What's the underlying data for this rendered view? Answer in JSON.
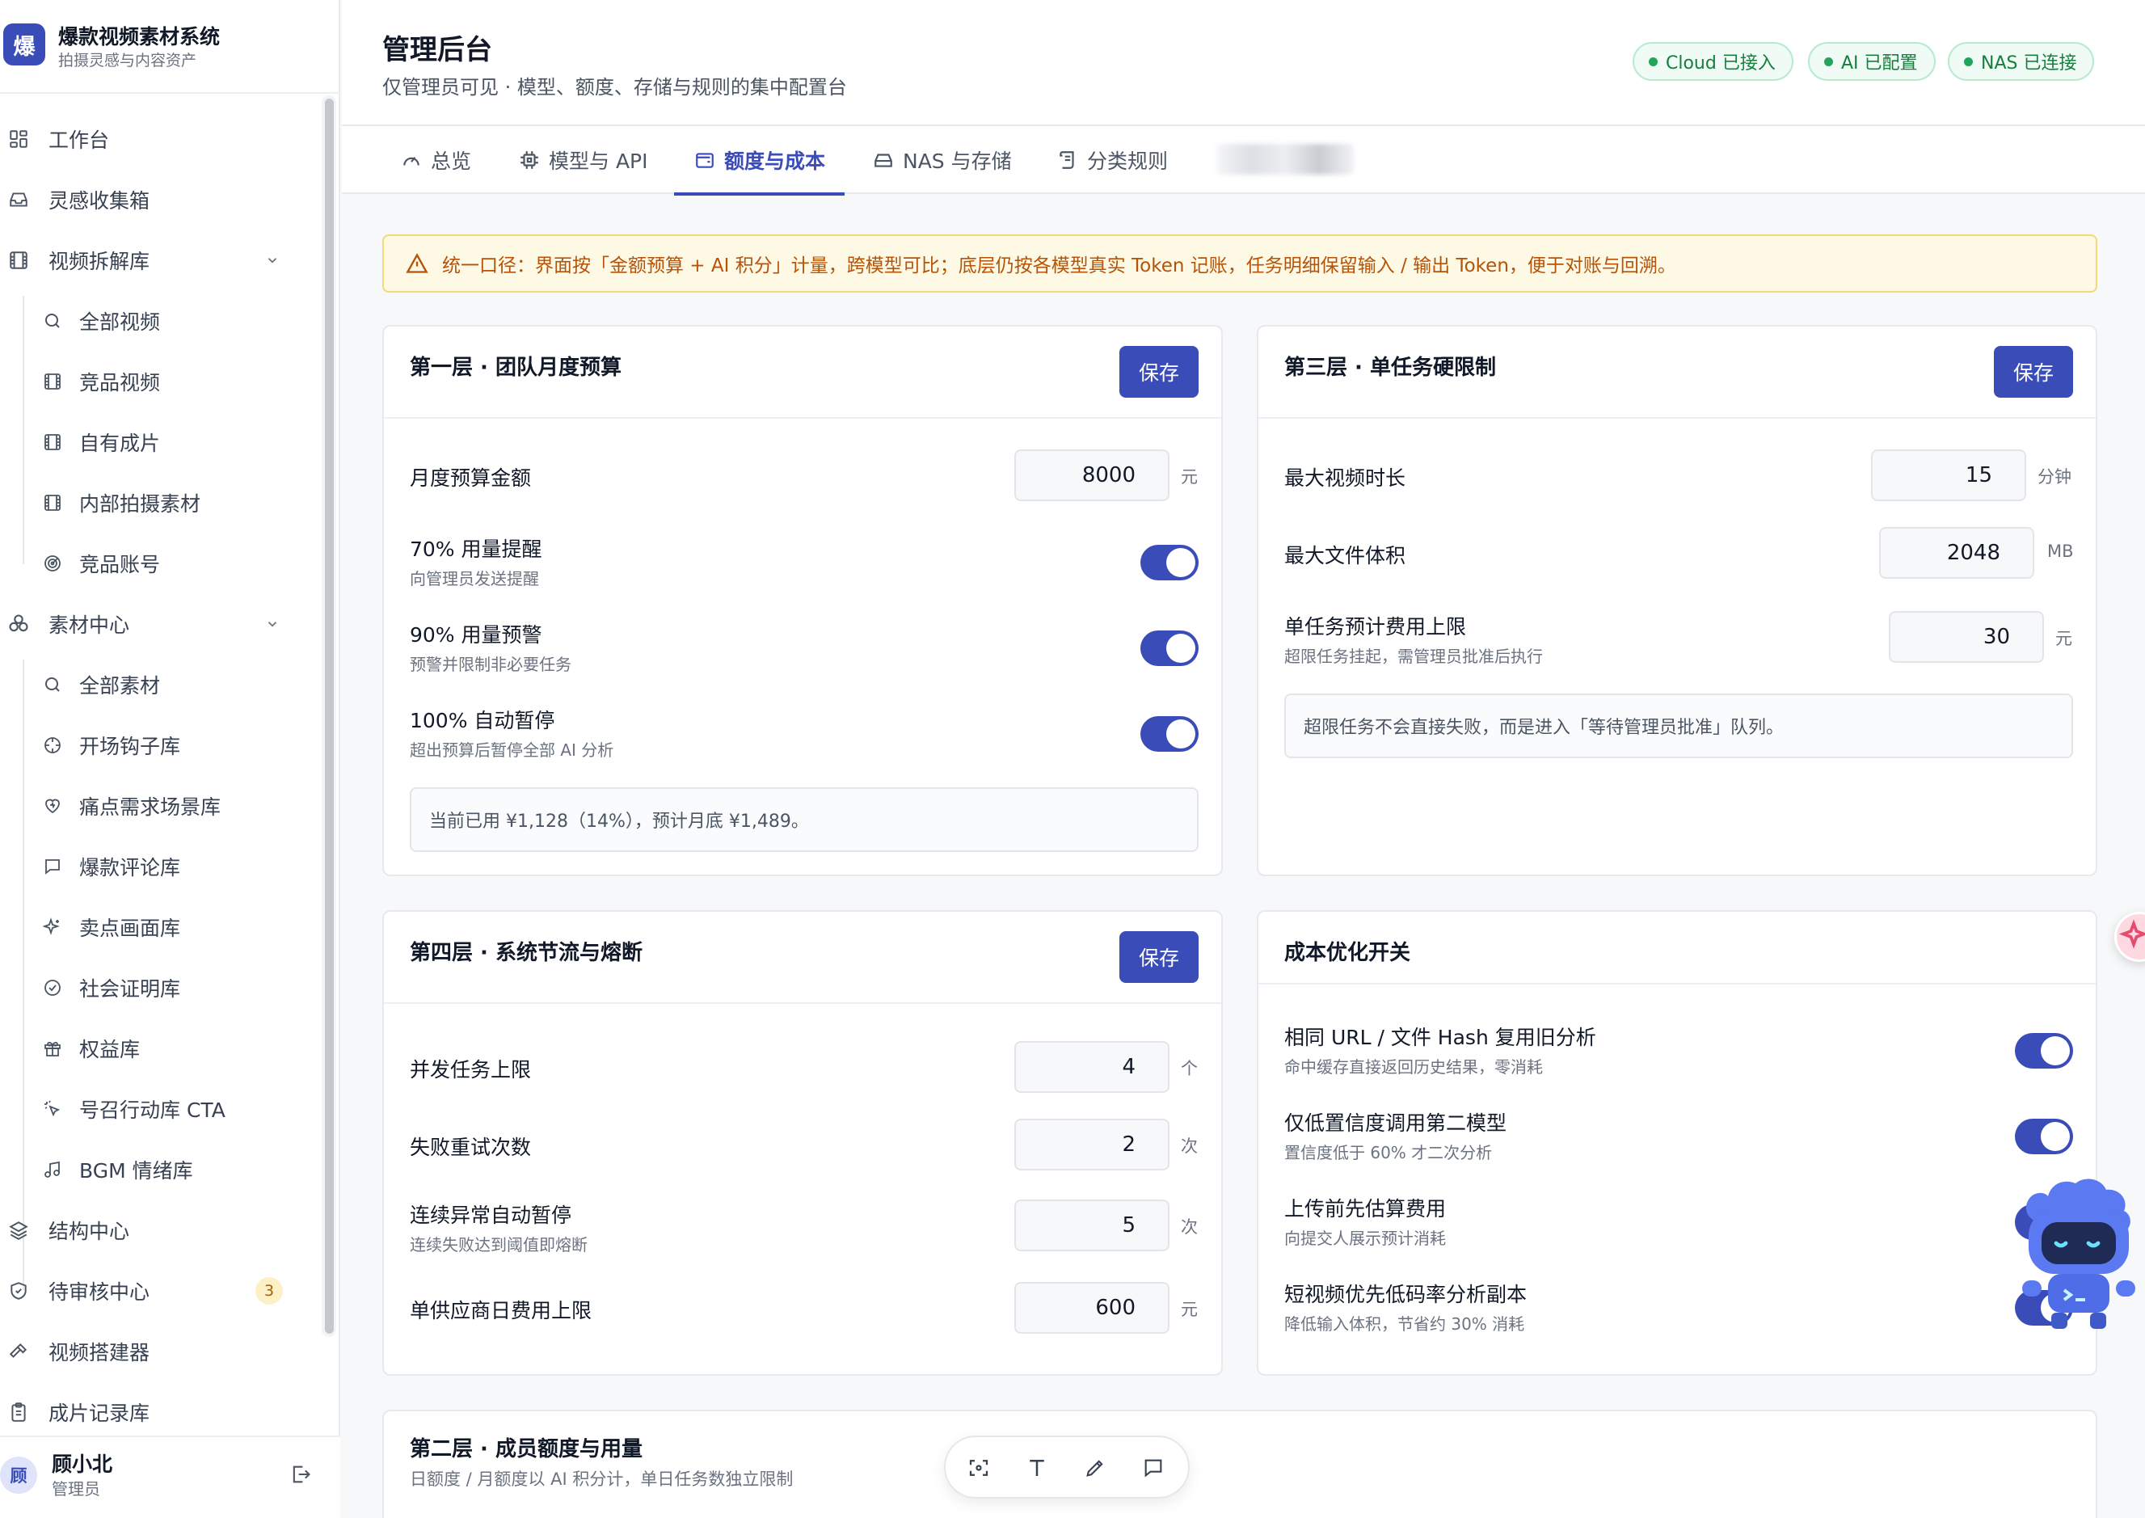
{
  "brand": {
    "logo_char": "爆",
    "name": "爆款视频素材系统",
    "subtitle": "拍摄灵感与内容资产"
  },
  "sidebar": {
    "items": [
      {
        "label": "工作台",
        "icon": "dashboard-icon"
      },
      {
        "label": "灵感收集箱",
        "icon": "inbox-icon"
      },
      {
        "label": "视频拆解库",
        "icon": "film-icon",
        "expanded": true
      },
      {
        "label": "全部视频",
        "icon": "search-icon"
      },
      {
        "label": "竞品视频",
        "icon": "film-icon"
      },
      {
        "label": "自有成片",
        "icon": "film-icon"
      },
      {
        "label": "内部拍摄素材",
        "icon": "film-icon"
      },
      {
        "label": "竞品账号",
        "icon": "radar-icon"
      },
      {
        "label": "素材中心",
        "icon": "assets-icon",
        "expanded": true
      },
      {
        "label": "全部素材",
        "icon": "search-icon"
      },
      {
        "label": "开场钩子库",
        "icon": "target-icon"
      },
      {
        "label": "痛点需求场景库",
        "icon": "heart-icon"
      },
      {
        "label": "爆款评论库",
        "icon": "comment-icon"
      },
      {
        "label": "卖点画面库",
        "icon": "sparkle-icon"
      },
      {
        "label": "社会证明库",
        "icon": "check-circle-icon"
      },
      {
        "label": "权益库",
        "icon": "gift-icon"
      },
      {
        "label": "号召行动库 CTA",
        "icon": "click-icon"
      },
      {
        "label": "BGM 情绪库",
        "icon": "music-icon"
      },
      {
        "label": "结构中心",
        "icon": "layers-icon"
      },
      {
        "label": "待审核中心",
        "icon": "shield-icon",
        "badge": "3"
      },
      {
        "label": "视频搭建器",
        "icon": "hammer-icon"
      },
      {
        "label": "成片记录库",
        "icon": "clipboard-icon"
      }
    ]
  },
  "user": {
    "avatar": "顾",
    "name": "顾小北",
    "role": "管理员"
  },
  "header": {
    "title": "管理后台",
    "subtitle": "仅管理员可见 · 模型、额度、存储与规则的集中配置台",
    "statuses": [
      "Cloud 已接入",
      "AI 已配置",
      "NAS 已连接"
    ],
    "accent_color": "#3a4cb8",
    "status_color": "#22a55a"
  },
  "tabs": [
    {
      "label": "总览",
      "icon": "gauge-icon"
    },
    {
      "label": "模型与 API",
      "icon": "chip-icon"
    },
    {
      "label": "额度与成本",
      "icon": "wallet-icon",
      "active": true
    },
    {
      "label": "NAS 与存储",
      "icon": "drive-icon"
    },
    {
      "label": "分类规则",
      "icon": "scroll-icon"
    }
  ],
  "alert": {
    "text": "统一口径：界面按「金额预算 + AI 积分」计量，跨模型可比；底层仍按各模型真实 Token 记账，任务明细保留输入 / 输出 Token，便于对账与回溯。",
    "icon": "warning-icon",
    "color": "#b45309"
  },
  "budget": {
    "title": "第一层 · 团队月度预算",
    "save": "保存",
    "amount_label": "月度预算金额",
    "amount_value": "8000",
    "amount_unit": "元",
    "toggles": [
      {
        "label": "70% 用量提醒",
        "hint": "向管理员发送提醒",
        "on": true
      },
      {
        "label": "90% 用量预警",
        "hint": "预警并限制非必要任务",
        "on": true
      },
      {
        "label": "100% 自动暂停",
        "hint": "超出预算后暂停全部 AI 分析",
        "on": true
      }
    ],
    "note": "当前已用 ¥1,128（14%），预计月底 ¥1,489。"
  },
  "limits": {
    "title": "第三层 · 单任务硬限制",
    "save": "保存",
    "fields": [
      {
        "label": "最大视频时长",
        "value": "15",
        "unit": "分钟"
      },
      {
        "label": "最大文件体积",
        "value": "2048",
        "unit": "MB"
      },
      {
        "label": "单任务预计费用上限",
        "hint": "超限任务挂起，需管理员批准后执行",
        "value": "30",
        "unit": "元"
      }
    ],
    "note": "超限任务不会直接失败，而是进入「等待管理员批准」队列。"
  },
  "throttle": {
    "title": "第四层 · 系统节流与熔断",
    "save": "保存",
    "fields": [
      {
        "label": "并发任务上限",
        "value": "4",
        "unit": "个"
      },
      {
        "label": "失败重试次数",
        "value": "2",
        "unit": "次"
      },
      {
        "label": "连续异常自动暂停",
        "hint": "连续失败达到阈值即熔断",
        "value": "5",
        "unit": "次"
      },
      {
        "label": "单供应商日费用上限",
        "value": "600",
        "unit": "元"
      }
    ]
  },
  "optimize": {
    "title": "成本优化开关",
    "toggles": [
      {
        "label": "相同 URL / 文件 Hash 复用旧分析",
        "hint": "命中缓存直接返回历史结果，零消耗",
        "on": true
      },
      {
        "label": "仅低置信度调用第二模型",
        "hint": "置信度低于 60% 才二次分析",
        "on": true
      },
      {
        "label": "上传前先估算费用",
        "hint": "向提交人展示预计消耗",
        "on": true
      },
      {
        "label": "短视频优先低码率分析副本",
        "hint": "降低输入体积，节省约 30% 消耗",
        "on": true
      }
    ]
  },
  "members": {
    "title": "第二层 · 成员额度与用量",
    "subtitle": "日额度 / 月额度以 AI 积分计，单日任务数独立限制"
  },
  "toolbar": {
    "tools": [
      "screenshot-icon",
      "text-icon",
      "pen-icon",
      "comment-icon"
    ]
  }
}
